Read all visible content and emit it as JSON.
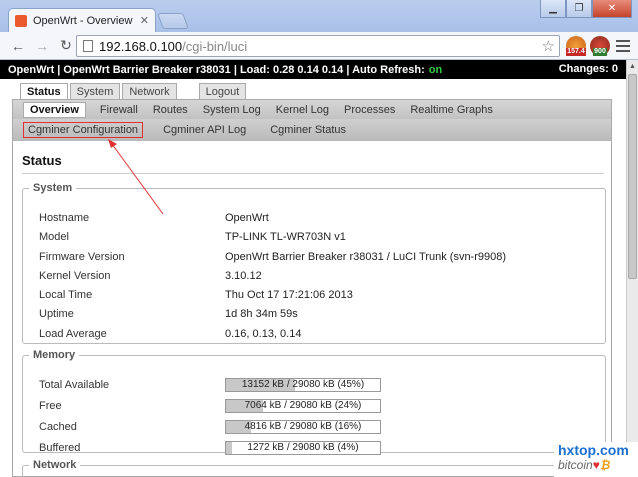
{
  "browser": {
    "tab_title": "OpenWrt - Overview - L",
    "tab_close": "✕",
    "url_host": "192.168.0.100",
    "url_path": "/cgi-bin/luci",
    "ext1_badge": "157.4",
    "ext2_badge": "900"
  },
  "header": {
    "text": "OpenWrt | OpenWrt Barrier Breaker r38031 | Load: 0.28 0.14 0.14 | Auto Refresh:",
    "auto_refresh": "on",
    "changes": "Changes: 0"
  },
  "main_tabs": [
    "Status",
    "System",
    "Network",
    "Logout"
  ],
  "sub_tabs": [
    "Overview",
    "Firewall",
    "Routes",
    "System Log",
    "Kernel Log",
    "Processes",
    "Realtime Graphs"
  ],
  "sub_tabs2": [
    "Cgminer Configuration",
    "Cgminer API Log",
    "Cgminer Status"
  ],
  "page_title": "Status",
  "system": {
    "legend": "System",
    "rows": [
      {
        "k": "Hostname",
        "v": "OpenWrt"
      },
      {
        "k": "Model",
        "v": "TP-LINK TL-WR703N v1"
      },
      {
        "k": "Firmware Version",
        "v": "OpenWrt Barrier Breaker r38031 / LuCI Trunk (svn-r9908)"
      },
      {
        "k": "Kernel Version",
        "v": "3.10.12"
      },
      {
        "k": "Local Time",
        "v": "Thu Oct 17 17:21:06 2013"
      },
      {
        "k": "Uptime",
        "v": "1d 8h 34m 59s"
      },
      {
        "k": "Load Average",
        "v": "0.16, 0.13, 0.14"
      }
    ]
  },
  "memory": {
    "legend": "Memory",
    "rows": [
      {
        "k": "Total Available",
        "v": "13152 kB / 29080 kB (45%)",
        "pct": 45
      },
      {
        "k": "Free",
        "v": "7064 kB / 29080 kB (24%)",
        "pct": 24
      },
      {
        "k": "Cached",
        "v": "4816 kB / 29080 kB (16%)",
        "pct": 16
      },
      {
        "k": "Buffered",
        "v": "1272 kB / 29080 kB (4%)",
        "pct": 4
      }
    ]
  },
  "network": {
    "legend": "Network"
  },
  "watermark": {
    "top": "hxtop.com",
    "bottom": "bitcoin"
  }
}
